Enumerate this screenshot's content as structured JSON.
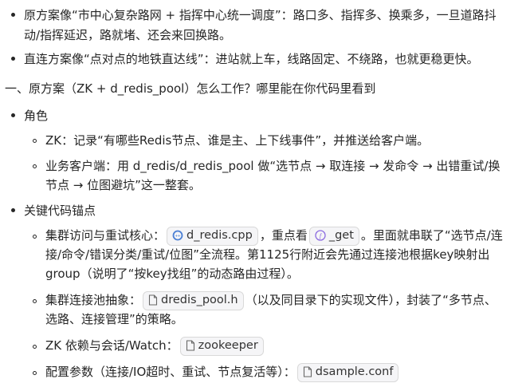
{
  "p1": {
    "l1": "原方案像“市中心复杂路网 + 指挥中心统一调度”：路口多、指挥多、换乘多，一旦道路抖",
    "l2": "动/指挥延迟，路就堵、还会来回换路。"
  },
  "p2": "直连方案像“点对点的地铁直达线”：进站就上车，线路固定、不绕路，也就更稳更快。",
  "heading": "一、原方案（ZK + d_redis_pool）怎么工作？哪里能在你代码里看到",
  "roles": {
    "title": "角色",
    "zk": "ZK：记录“有哪些Redis节点、谁是主、上下线事件”，并推送给客户端。",
    "client_l1": "业务客户端：用 d_redis/d_redis_pool 做“选节点 → 取连接 → 发命令 → 出错重试/换",
    "client_l2": "节点 → 位图避坑”这一整套。"
  },
  "anchors": {
    "title": "关键代码锚点",
    "a1_prefix": "集群访问与重试核心：",
    "a1_file": "d_redis.cpp",
    "a1_mid": "，重点看",
    "a1_func": "_get",
    "a1_suffix": "。里面就串联了“选节点/连",
    "a1_l2": "接/命令/错误分类/重试/位图”全流程。第1125行附近会先通过连接池根据key映射出",
    "a1_l3": "group（说明了“按key找组”的动态路由过程）。",
    "a2_prefix": "集群连接池抽象：",
    "a2_file": "dredis_pool.h",
    "a2_suffix": "（以及同目录下的实现文件），封装了“多节点、",
    "a2_l2": "选路、连接管理”的策略。",
    "a3_prefix": "ZK 依赖与会话/Watch：",
    "a3_file": "zookeeper",
    "a4_prefix": "配置参数（连接/IO超时、重试、节点复活等）：",
    "a4_file": "dsample.conf"
  },
  "icons": {
    "cpp": "cpp-file-icon",
    "func": "function-icon",
    "file": "file-icon"
  }
}
